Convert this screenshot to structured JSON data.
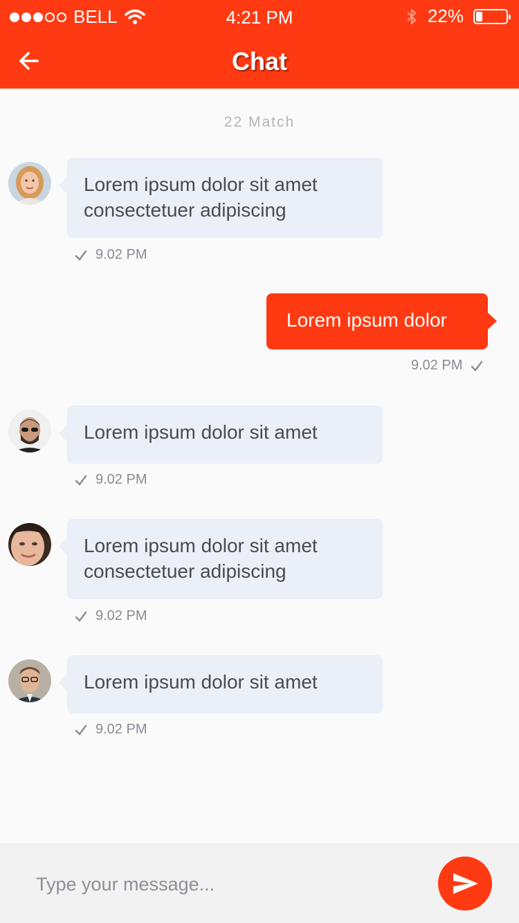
{
  "status_bar": {
    "carrier": "BELL",
    "time": "4:21 PM",
    "battery": "22%",
    "battery_level": 0.22,
    "signal_bars_filled": 3,
    "signal_bars_total": 5
  },
  "header": {
    "title": "Chat",
    "back_icon": "arrow-left-icon"
  },
  "date_separator": "22 Match",
  "messages": [
    {
      "direction": "incoming",
      "avatar": "avatar-woman-blonde",
      "lines": [
        "Lorem ipsum dolor sit amet",
        "consectetuer adipiscing"
      ],
      "time": "9.02 PM"
    },
    {
      "direction": "outgoing",
      "lines": [
        "Lorem ipsum dolor"
      ],
      "time": "9.02 PM"
    },
    {
      "direction": "incoming",
      "avatar": "avatar-man-sunglasses",
      "lines": [
        "Lorem ipsum dolor sit amet"
      ],
      "time": "9.02 PM"
    },
    {
      "direction": "incoming",
      "avatar": "avatar-woman-closeup",
      "lines": [
        "Lorem ipsum dolor sit amet",
        "consectetuer adipiscing"
      ],
      "time": "9.02 PM"
    },
    {
      "direction": "incoming",
      "avatar": "avatar-man-glasses",
      "lines": [
        "Lorem ipsum dolor sit amet"
      ],
      "time": "9.02 PM"
    }
  ],
  "composer": {
    "placeholder": "Type your message...",
    "send_icon": "send-icon"
  },
  "colors": {
    "accent": "#ff3a12",
    "incoming_bubble": "#ebeff8",
    "background": "#fafafa"
  }
}
